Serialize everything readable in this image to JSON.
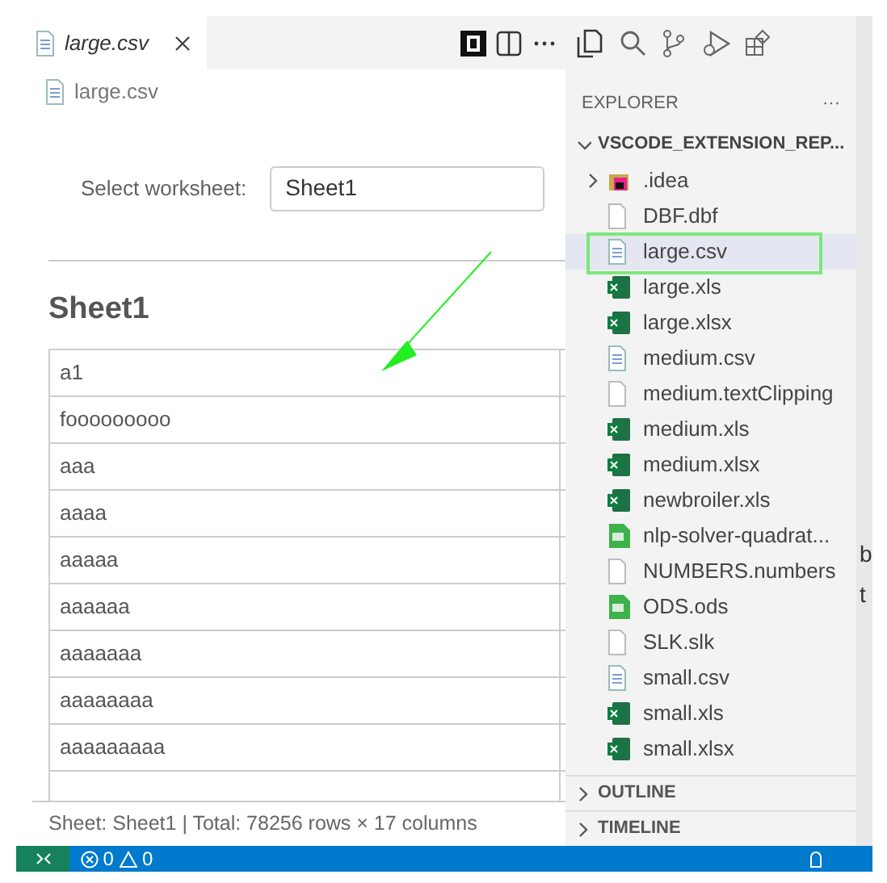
{
  "editor": {
    "tabs": [
      {
        "label": "large.csv",
        "selected": true
      }
    ],
    "breadcrumb": "large.csv",
    "worksheet": {
      "label": "Select worksheet:",
      "value": "Sheet1"
    },
    "sheet_title": "Sheet1",
    "table": {
      "rows": [
        [
          "a1"
        ],
        [
          "fooooooooo"
        ],
        [
          "aaa"
        ],
        [
          "aaaa"
        ],
        [
          "aaaaa"
        ],
        [
          "aaaaaa"
        ],
        [
          "aaaaaaa"
        ],
        [
          "aaaaaaaa"
        ],
        [
          "aaaaaaaaa"
        ]
      ]
    },
    "status_text": "Sheet: Sheet1 | Total: 78256 rows × 17 columns"
  },
  "sidebar": {
    "title": "EXPLORER",
    "more": "···",
    "root": {
      "label": "VSCODE_EXTENSION_REP...",
      "expanded": true
    },
    "items": [
      {
        "label": ".idea",
        "kind": "folder",
        "expanded": false,
        "selected": false
      },
      {
        "label": "DBF.dbf",
        "kind": "blank",
        "selected": false
      },
      {
        "label": "large.csv",
        "kind": "text",
        "selected": true
      },
      {
        "label": "large.xls",
        "kind": "excel",
        "selected": false
      },
      {
        "label": "large.xlsx",
        "kind": "excel",
        "selected": false
      },
      {
        "label": "medium.csv",
        "kind": "text",
        "selected": false
      },
      {
        "label": "medium.textClipping",
        "kind": "blank",
        "selected": false
      },
      {
        "label": "medium.xls",
        "kind": "excel",
        "selected": false
      },
      {
        "label": "medium.xlsx",
        "kind": "excel",
        "selected": false
      },
      {
        "label": "newbroiler.xls",
        "kind": "excel",
        "selected": false
      },
      {
        "label": "nlp-solver-quadrat...",
        "kind": "ods",
        "selected": false
      },
      {
        "label": "NUMBERS.numbers",
        "kind": "blank",
        "selected": false
      },
      {
        "label": "ODS.ods",
        "kind": "ods",
        "selected": false
      },
      {
        "label": "SLK.slk",
        "kind": "blank",
        "selected": false
      },
      {
        "label": "small.csv",
        "kind": "text",
        "selected": false
      },
      {
        "label": "small.xls",
        "kind": "excel",
        "selected": false
      },
      {
        "label": "small.xlsx",
        "kind": "excel",
        "selected": false
      }
    ],
    "sections": [
      {
        "label": "OUTLINE",
        "expanded": false
      },
      {
        "label": "TIMELINE",
        "expanded": false
      }
    ]
  },
  "right_edge_text": [
    "b",
    "t"
  ],
  "status_bar": {
    "errors": "0",
    "warnings": "0"
  }
}
